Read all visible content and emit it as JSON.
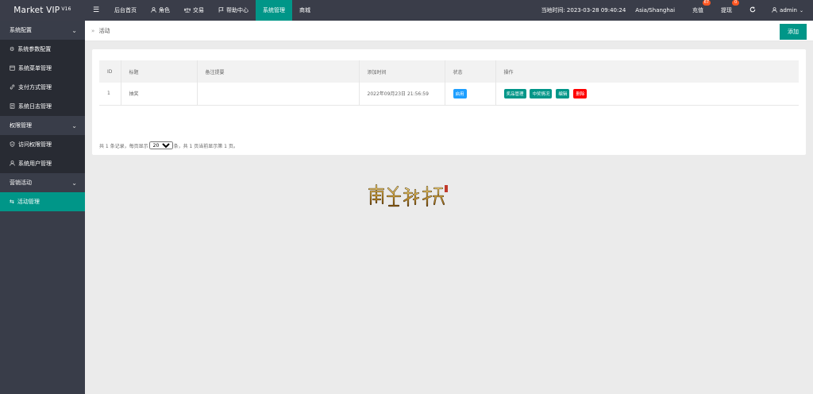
{
  "app": {
    "title": "Market VIP",
    "version": "V16"
  },
  "topnav": {
    "menu_icon": "hamburger-icon",
    "items": [
      {
        "label": "后台首页",
        "icon": ""
      },
      {
        "label": "角色",
        "icon": "user-icon"
      },
      {
        "label": "交易",
        "icon": "scale-icon"
      },
      {
        "label": "帮助中心",
        "icon": "flag-icon"
      },
      {
        "label": "系统管理",
        "icon": "",
        "active": true
      },
      {
        "label": "商城",
        "icon": ""
      }
    ]
  },
  "topright": {
    "time_label": "当地时间:",
    "time_value": "2023-03-28 09:40:24",
    "timezone": "Asia/Shanghai",
    "recharge_label": "充值",
    "recharge_badge": "67",
    "withdraw_label": "提现",
    "withdraw_badge": "0",
    "refresh_icon": "refresh-icon",
    "user_label": "admin"
  },
  "sidebar": {
    "groups": [
      {
        "label": "系统配置",
        "items": [
          {
            "label": "系统参数配置",
            "icon": "gear-icon"
          },
          {
            "label": "系统菜单管理",
            "icon": "calendar-icon"
          },
          {
            "label": "支付方式管理",
            "icon": "link-icon"
          },
          {
            "label": "系统日志管理",
            "icon": "log-icon"
          }
        ]
      },
      {
        "label": "权限管理",
        "items": [
          {
            "label": "访问权限管理",
            "icon": "shield-icon"
          },
          {
            "label": "系统用户管理",
            "icon": "user-icon"
          }
        ]
      },
      {
        "label": "营销活动",
        "items": [
          {
            "label": "活动管理",
            "icon": "swap-icon",
            "active": true
          }
        ]
      }
    ]
  },
  "page": {
    "breadcrumb_sep": "»",
    "breadcrumb": "活动",
    "add_label": "添加"
  },
  "table": {
    "headers": [
      "ID",
      "标题",
      "备注提要",
      "添加时间",
      "状态",
      "操作"
    ],
    "rows": [
      {
        "id": "1",
        "title": "抽奖",
        "remark": "",
        "time": "2022年09月23日 21:56:59",
        "status": "启用",
        "actions": [
          "奖品管理",
          "中奖情况",
          "编辑",
          "删除"
        ]
      }
    ]
  },
  "pager": {
    "prefix": "共 1 条记录，每页显示",
    "per_page": "20",
    "suffix": "条，共 1 页当前显示第 1 页。"
  },
  "colors": {
    "accent": "#009688",
    "danger": "#ff0000",
    "info": "#1e9fff",
    "dark": "#393d49"
  }
}
